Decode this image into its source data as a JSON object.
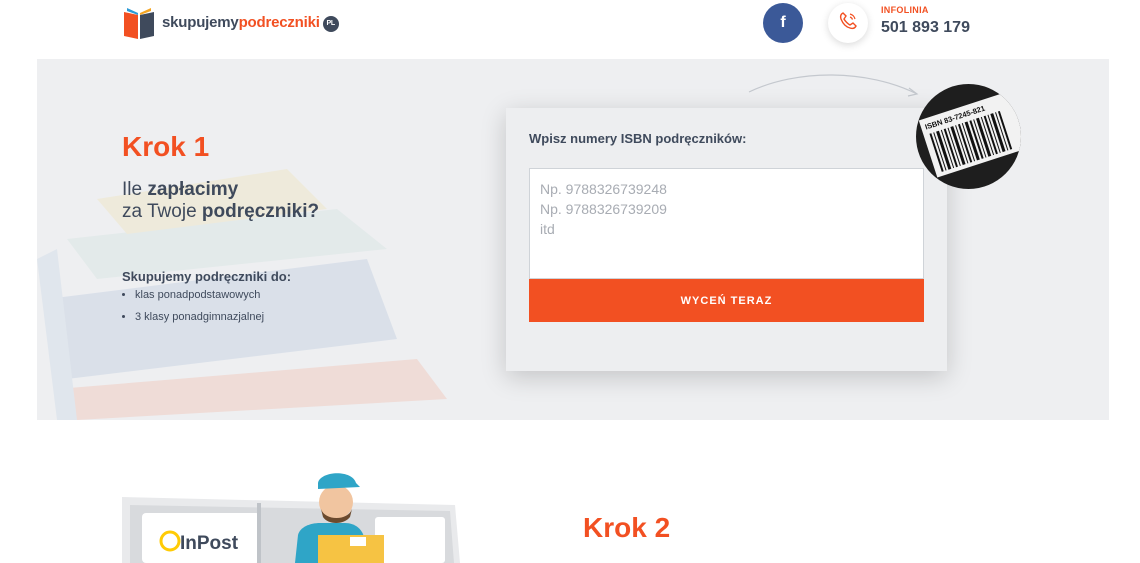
{
  "header": {
    "logo_dark": "skupujemy",
    "logo_orange": "podreczniki",
    "logo_badge": "PL",
    "facebook_glyph": "f",
    "infolinia_label": "INFOLINIA",
    "phone_number": "501 893 179"
  },
  "step1": {
    "title": "Krok 1",
    "headline_plain1": "Ile ",
    "headline_bold1": "zapłacimy",
    "headline_plain2": "za Twoje ",
    "headline_bold2": "podręczniki?",
    "buy_title": "Skupujemy podręczniki do:",
    "buy_items": [
      "klas ponadpodstawowych",
      "3 klasy ponadgimnazjalnej"
    ],
    "isbn_label": "Wpisz numery ISBN podręczników:",
    "isbn_placeholder": "Np. 9788326739248\nNp. 9788326739209\nitd",
    "isbn_button": "WYCEŃ TERAZ",
    "barcode_text": "ISBN 83-7245-821"
  },
  "step2": {
    "title": "Krok 2",
    "inpost_label": "InPost"
  },
  "colors": {
    "accent": "#f25022",
    "text_dark": "#3f4a5c",
    "facebook": "#3b5998",
    "section_bg": "#eeeff1"
  },
  "icons": [
    "book-logo-icon",
    "facebook-icon",
    "phone-icon",
    "arrow-icon",
    "barcode-icon",
    "courier-icon"
  ]
}
